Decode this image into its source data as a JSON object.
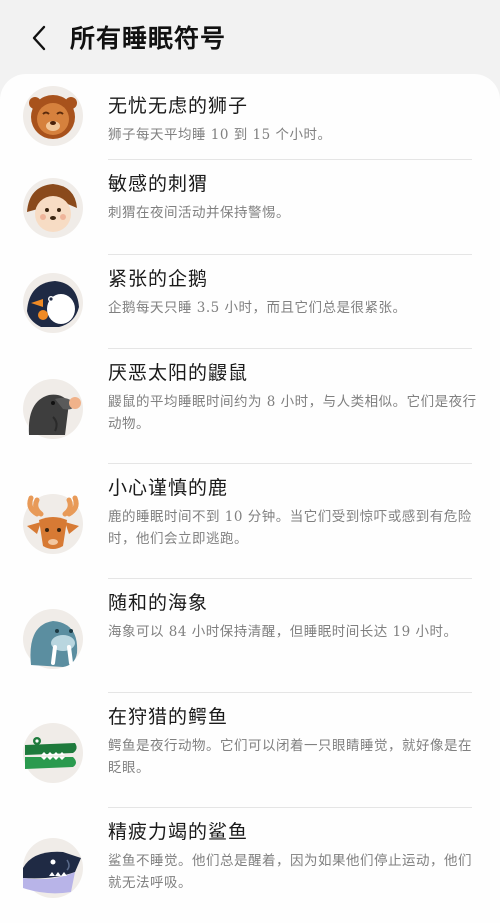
{
  "header": {
    "title": "所有睡眠符号",
    "back_icon": "chevron-left-icon"
  },
  "items": [
    {
      "title": "无忧无虑的狮子",
      "desc": "狮子每天平均睡 10 到 15 个小时。",
      "icon": "lion-icon"
    },
    {
      "title": "敏感的刺猬",
      "desc": "刺猬在夜间活动并保持警惕。",
      "icon": "hedgehog-icon"
    },
    {
      "title": "紧张的企鹅",
      "desc": "企鹅每天只睡 3.5 小时，而且它们总是很紧张。",
      "icon": "penguin-icon"
    },
    {
      "title": "厌恶太阳的鼹鼠",
      "desc": "鼹鼠的平均睡眠时间约为 8 小时，与人类相似。它们是夜行动物。",
      "icon": "mole-icon"
    },
    {
      "title": "小心谨慎的鹿",
      "desc": "鹿的睡眠时间不到 10 分钟。当它们受到惊吓或感到有危险时，他们会立即逃跑。",
      "icon": "deer-icon"
    },
    {
      "title": "随和的海象",
      "desc": "海象可以 84 小时保持清醒，但睡眠时间长达 19 小时。",
      "icon": "walrus-icon"
    },
    {
      "title": "在狩猎的鳄鱼",
      "desc": "鳄鱼是夜行动物。它们可以闭着一只眼睛睡觉，就好像是在眨眼。",
      "icon": "crocodile-icon"
    },
    {
      "title": "精疲力竭的鲨鱼",
      "desc": "鲨鱼不睡觉。他们总是醒着，因为如果他们停止运动，他们就无法呼吸。",
      "icon": "shark-icon"
    }
  ]
}
